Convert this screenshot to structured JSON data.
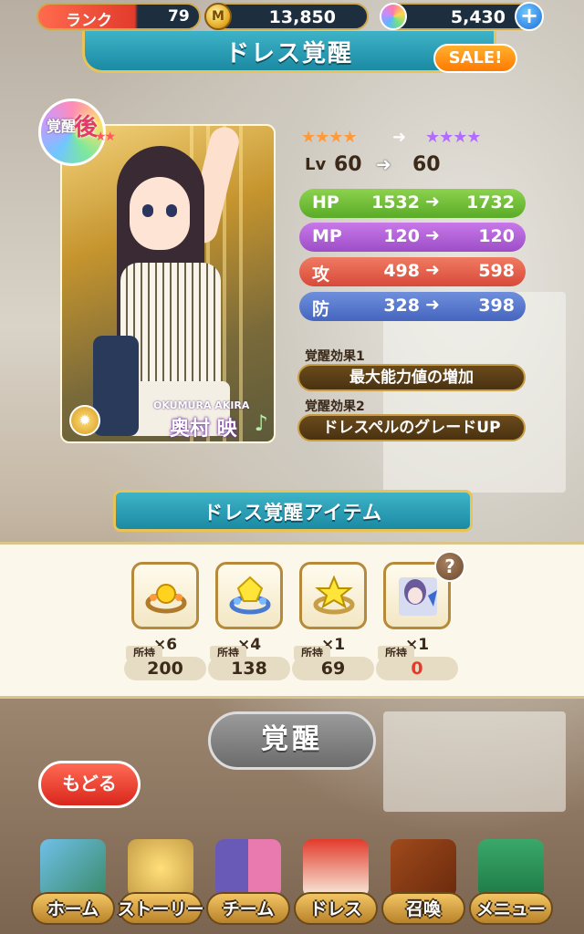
{
  "top": {
    "rank_label": "ランク",
    "rank_value": "79",
    "coin_value": "13,850",
    "gem_value": "5,430",
    "coin_symbol": "M",
    "plus_symbol": "+"
  },
  "title": "ドレス覚醒",
  "sale_label": "SALE!",
  "card": {
    "badge_after_a": "覚醒",
    "badge_after_b": "後",
    "romaji": "OKUMURA AKIRA",
    "name": "奥村 映",
    "note_symbol": "♪",
    "medal_symbol": "✹",
    "stars": "★★"
  },
  "rarity": {
    "before": "★★★★",
    "arrow": "➜",
    "after": "★★★★"
  },
  "level": {
    "label": "Lv",
    "from": "60",
    "to": "60",
    "arrow": "➜"
  },
  "stats": [
    {
      "key": "HP",
      "from": "1532",
      "to": "1732",
      "arrow": "➜"
    },
    {
      "key": "MP",
      "from": "120",
      "to": "120",
      "arrow": "➜"
    },
    {
      "key": "攻",
      "from": "498",
      "to": "598",
      "arrow": "➜"
    },
    {
      "key": "防",
      "from": "328",
      "to": "398",
      "arrow": "➜"
    }
  ],
  "effects": [
    {
      "label": "覚醒効果1",
      "value": "最大能力値の増加"
    },
    {
      "label": "覚醒効果2",
      "value": "ドレスペルのグレードUP"
    }
  ],
  "items_header": "ドレス覚醒アイテム",
  "items": [
    {
      "count": "×6",
      "owned_label": "所持",
      "owned": "200"
    },
    {
      "count": "×4",
      "owned_label": "所持",
      "owned": "138"
    },
    {
      "count": "×1",
      "owned_label": "所持",
      "owned": "69"
    },
    {
      "count": "×1",
      "owned_label": "所持",
      "owned": "0"
    }
  ],
  "help_symbol": "?",
  "awaken_button": "覚醒",
  "back_button": "もどる",
  "nav": [
    "ホーム",
    "ストーリー",
    "チーム",
    "ドレス",
    "召喚",
    "メニュー"
  ],
  "colors": {
    "hp": "#6cbd36",
    "mp": "#b060d8",
    "attack": "#e2543f",
    "defense": "#5878cf",
    "banner": "#2aa0b8",
    "owned_zero": "#e23b2c"
  }
}
